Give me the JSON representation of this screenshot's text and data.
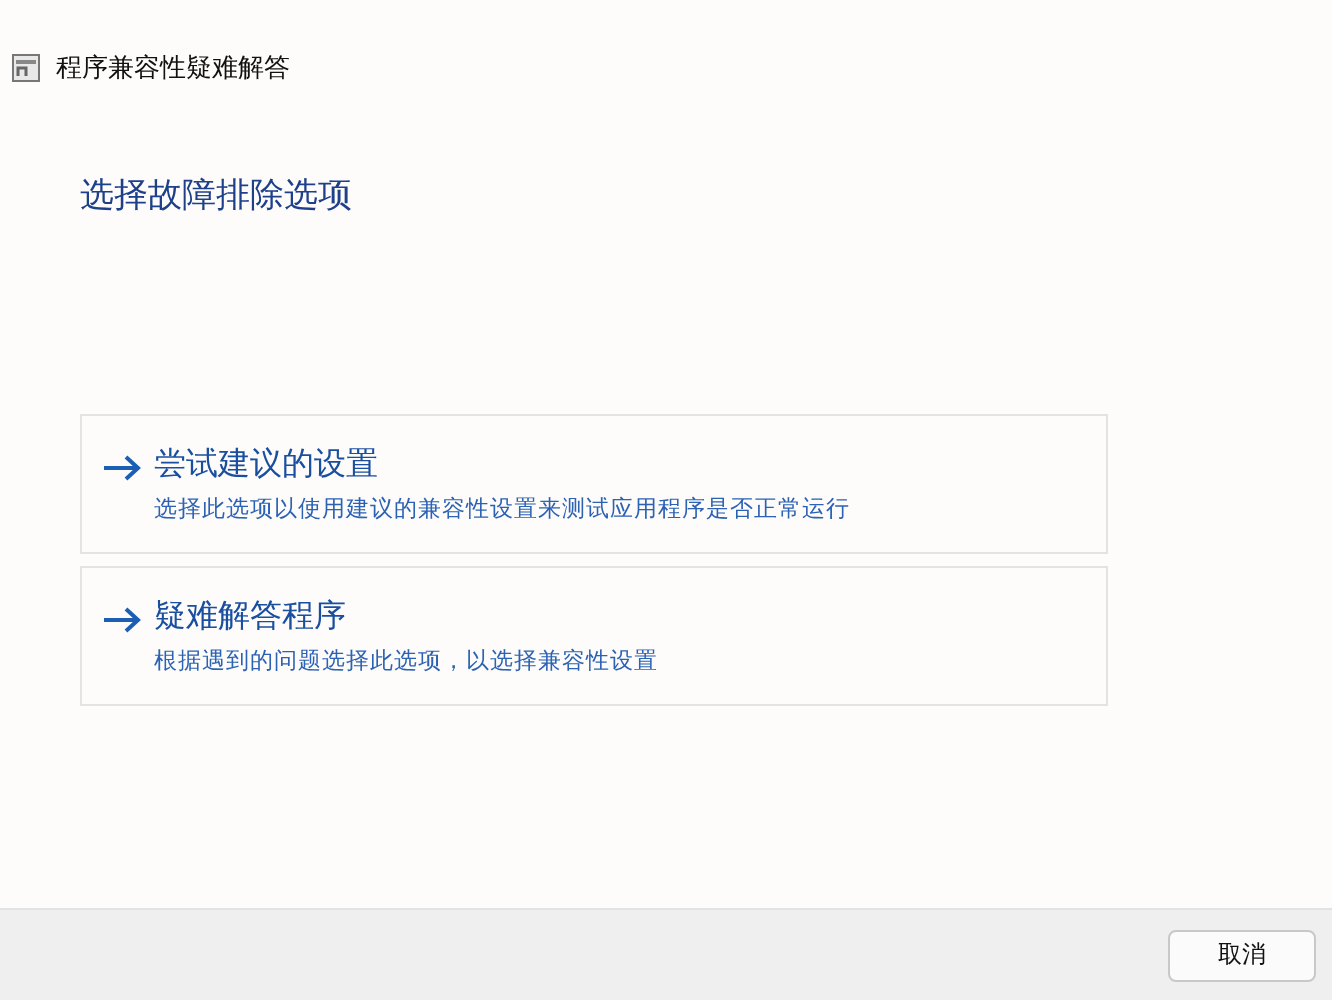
{
  "window": {
    "title": "程序兼容性疑难解答"
  },
  "heading": "选择故障排除选项",
  "options": [
    {
      "title": "尝试建议的设置",
      "description": "选择此选项以使用建议的兼容性设置来测试应用程序是否正常运行"
    },
    {
      "title": "疑难解答程序",
      "description": "根据遇到的问题选择此选项，以选择兼容性设置"
    }
  ],
  "buttons": [
    "取消"
  ]
}
